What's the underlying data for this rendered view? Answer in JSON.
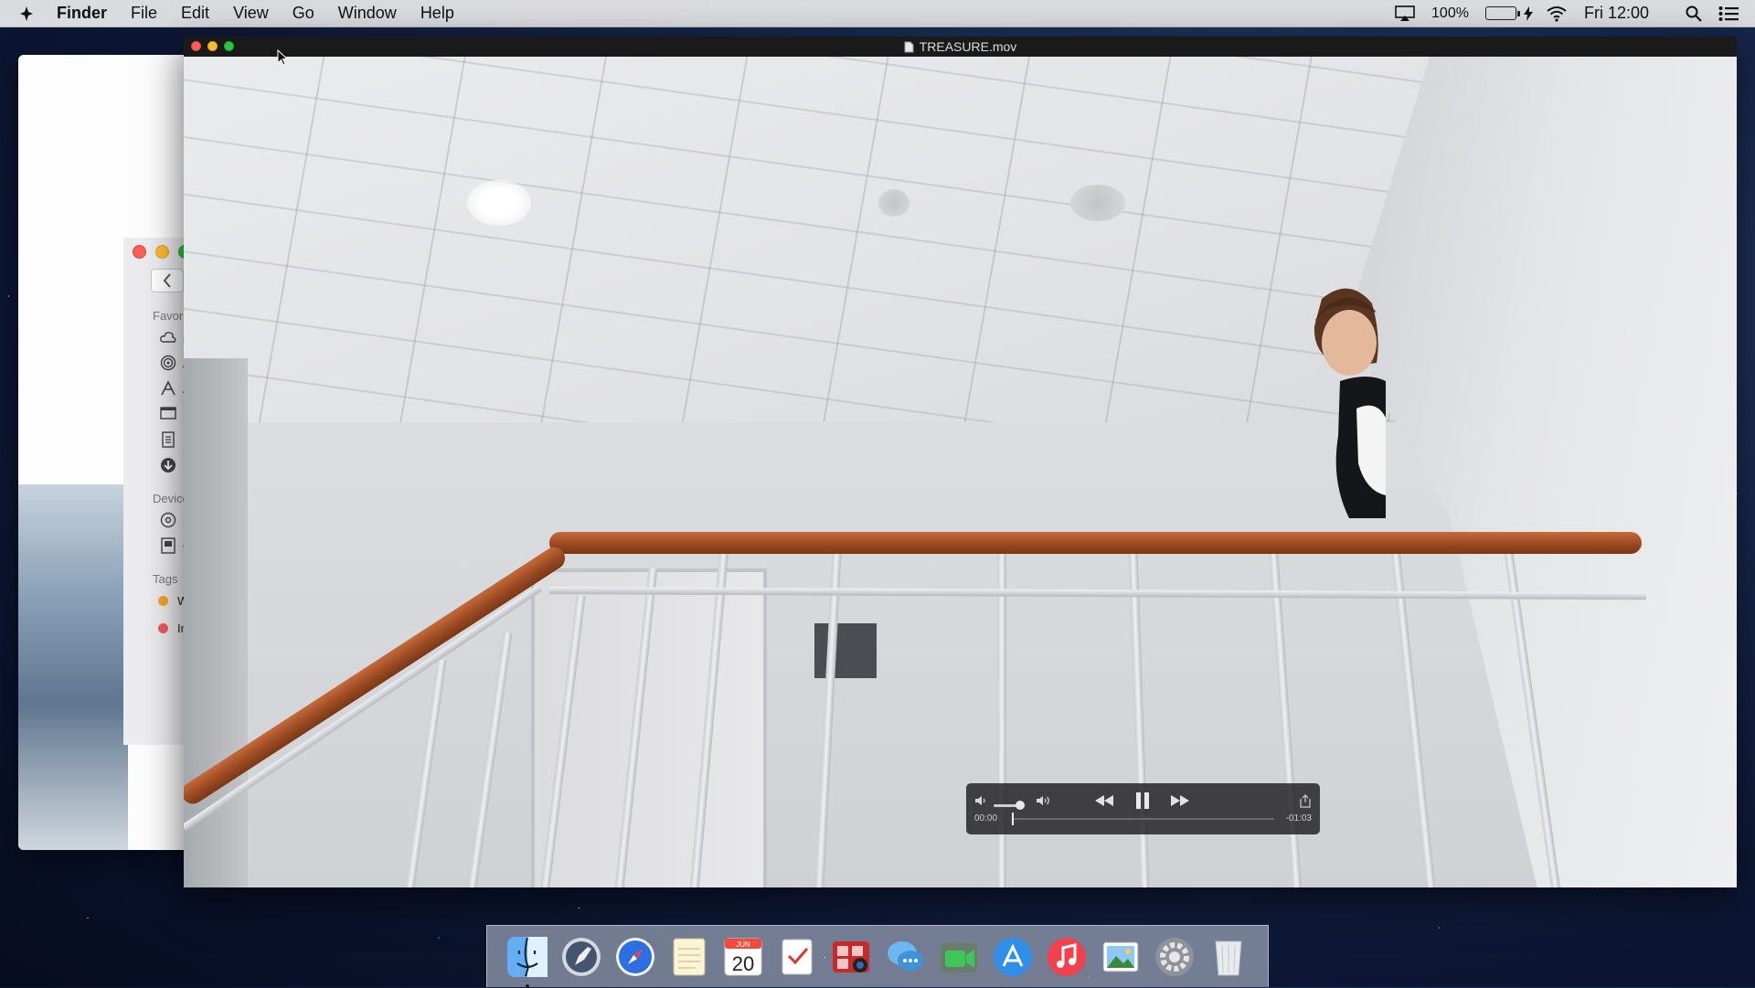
{
  "menubar": {
    "app_name": "Finder",
    "menus": [
      "File",
      "Edit",
      "View",
      "Go",
      "Window",
      "Help"
    ],
    "battery_percent": "100%",
    "battery_level": 1.0,
    "clock": "Fri 12:00"
  },
  "finder": {
    "sidebar": {
      "favorites_heading": "Favorites",
      "favorites": [
        "iC",
        "Ai",
        "Ap",
        "De",
        "Do",
        "Do"
      ],
      "devices_heading": "Devices",
      "devices": [
        "Re",
        "OS"
      ],
      "tags_heading": "Tags",
      "tags": [
        {
          "label": "W",
          "color": "#f5a623"
        },
        {
          "label": "Im",
          "color": "#ef5d5d"
        }
      ]
    }
  },
  "player": {
    "title": "TREASURE.mov",
    "elapsed": "00:00",
    "remaining": "-01:03",
    "progress": 0.0,
    "volume": 0.85
  },
  "dock": {
    "items": [
      {
        "name": "finder-icon"
      },
      {
        "name": "launchpad-icon"
      },
      {
        "name": "safari-icon"
      },
      {
        "name": "notes-icon"
      },
      {
        "name": "calendar-icon",
        "month": "JUN",
        "day": "20"
      },
      {
        "name": "reminders-icon"
      },
      {
        "name": "photo-booth-icon"
      },
      {
        "name": "messages-icon"
      },
      {
        "name": "facetime-icon"
      },
      {
        "name": "app-store-icon"
      },
      {
        "name": "itunes-icon"
      },
      {
        "name": "photos-icon"
      },
      {
        "name": "system-preferences-icon"
      },
      {
        "name": "trash-icon"
      }
    ]
  },
  "colors": {
    "accent_blue": "#2d7cf6",
    "battery_green": "#2bd12b"
  }
}
